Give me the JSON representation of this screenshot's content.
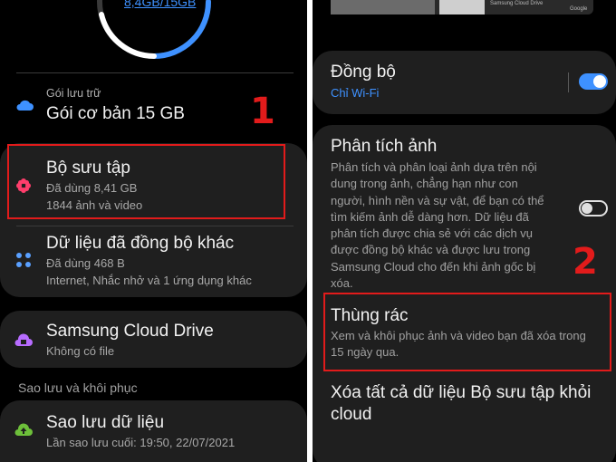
{
  "left": {
    "storage_usage": "8,4GB/15GB",
    "plan": {
      "label": "Gói lưu trữ",
      "value": "Gói cơ bản 15 GB",
      "icon": "cloud-icon"
    },
    "gallery": {
      "title": "Bộ sưu tập",
      "used": "Đã dùng 8,41 GB",
      "count": "1844 ảnh và video",
      "icon": "gallery-flower-icon"
    },
    "other_synced": {
      "title": "Dữ liệu đã đồng bộ khác",
      "used": "Đã dùng 468 B",
      "apps": "Internet, Nhắc nhở và 1 ứng dụng khác",
      "icon": "apps-grid-icon"
    },
    "cloud_drive": {
      "title": "Samsung Cloud Drive",
      "status": "Không có file",
      "icon": "cloud-drive-icon"
    },
    "section_backup": "Sao lưu và khôi phục",
    "backup": {
      "title": "Sao lưu dữ liệu",
      "last": "Lần sao lưu cuối: 19:50, 22/07/2021",
      "icon": "cloud-upload-icon"
    },
    "step_badge": "1"
  },
  "right": {
    "thumb_labels": {
      "drive": "Samsung Cloud Drive",
      "google": "Google"
    },
    "sync": {
      "title": "Đồng bộ",
      "sub": "Chỉ Wi-Fi",
      "enabled": true
    },
    "analyze": {
      "title": "Phân tích ảnh",
      "desc_lines": [
        "Phân tích và phân loại ảnh dựa trên nội",
        "dung trong ảnh, chẳng hạn như con",
        "người, hình nền và sự vật, để bạn có thể",
        "tìm kiếm ảnh dễ dàng hơn. Dữ liệu đã",
        "phân tích được chia sẻ với các dịch vụ",
        "được đồng bộ khác và được lưu trong",
        "Samsung Cloud cho đến khi ảnh gốc bị",
        "xóa."
      ],
      "enabled": false
    },
    "trash": {
      "title": "Thùng rác",
      "desc_lines": [
        "Xem và khôi phục ảnh và video bạn đã xóa trong",
        "15 ngày qua."
      ]
    },
    "delete_all": {
      "lines": [
        "Xóa tất cả dữ liệu Bộ sưu tập khỏi",
        "cloud"
      ]
    },
    "step_badge": "2"
  },
  "colors": {
    "accent": "#3e91ff",
    "highlight": "#e21b1b",
    "card": "#1f1f1f"
  }
}
